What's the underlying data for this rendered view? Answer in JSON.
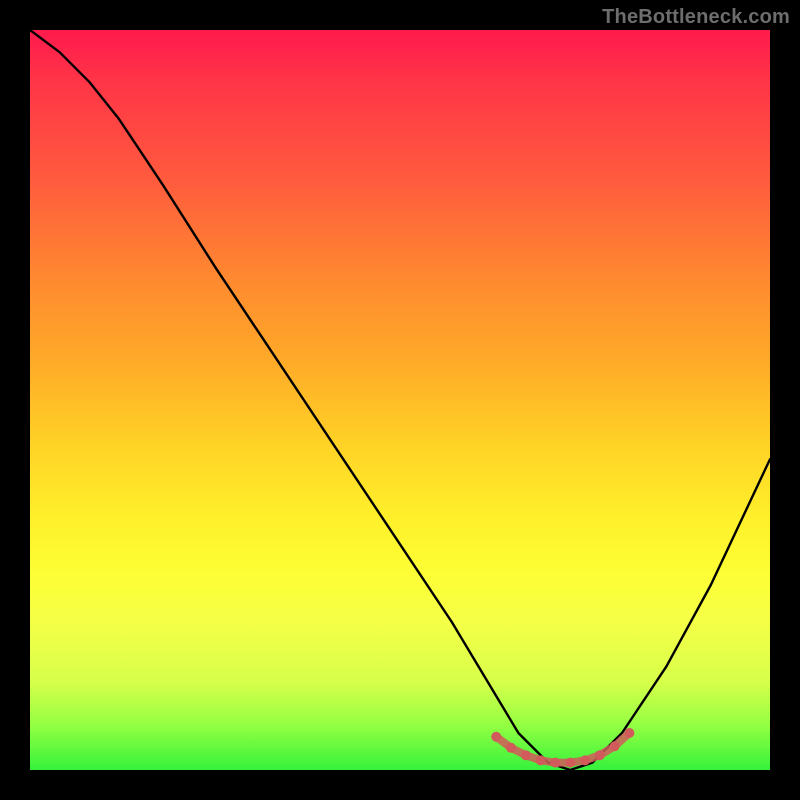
{
  "watermark": "TheBottleneck.com",
  "chart_data": {
    "type": "line",
    "title": "",
    "xlabel": "",
    "ylabel": "",
    "xlim": [
      0,
      100
    ],
    "ylim": [
      0,
      100
    ],
    "grid": false,
    "legend": false,
    "series": [
      {
        "name": "bottleneck-curve",
        "color": "#000000",
        "x": [
          0,
          4,
          8,
          12,
          18,
          25,
          33,
          41,
          49,
          57,
          60,
          63,
          66,
          70,
          73,
          76,
          80,
          86,
          92,
          100
        ],
        "y": [
          100,
          97,
          93,
          88,
          79,
          68,
          56,
          44,
          32,
          20,
          15,
          10,
          5,
          1,
          0,
          1,
          5,
          14,
          25,
          42
        ]
      },
      {
        "name": "optimal-band-markers",
        "color": "#d15b5b",
        "type": "scatter",
        "x": [
          63,
          65,
          67,
          69,
          71,
          73,
          75,
          77,
          79,
          81
        ],
        "y": [
          4.5,
          3.0,
          2.0,
          1.3,
          1.0,
          1.0,
          1.3,
          2.0,
          3.2,
          5.0
        ]
      }
    ],
    "background_gradient": {
      "direction": "vertical",
      "stops": [
        {
          "pos": 0.0,
          "color": "#ff1a4d"
        },
        {
          "pos": 0.2,
          "color": "#ff5a3e"
        },
        {
          "pos": 0.45,
          "color": "#ffab28"
        },
        {
          "pos": 0.66,
          "color": "#fff02a"
        },
        {
          "pos": 0.88,
          "color": "#d8ff4a"
        },
        {
          "pos": 1.0,
          "color": "#35f23c"
        }
      ]
    }
  }
}
